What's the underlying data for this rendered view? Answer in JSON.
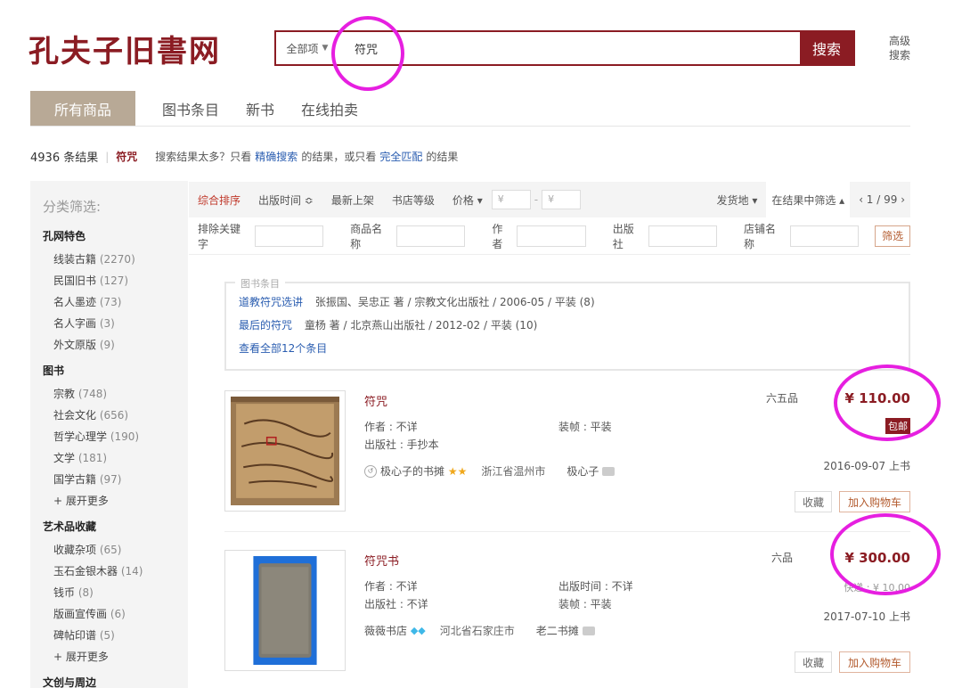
{
  "header": {
    "logo": "孔夫子旧書网",
    "scope": "全部项",
    "query": "符咒",
    "search_button": "搜索",
    "advanced_line1": "高级",
    "advanced_line2": "搜索"
  },
  "tabs": [
    "所有商品",
    "图书条目",
    "新书",
    "在线拍卖"
  ],
  "results": {
    "count": "4936 条结果",
    "keyword": "符咒",
    "hint_pre": "搜索结果太多？只看",
    "hint_link1": "精确搜索",
    "hint_mid": "的结果，或只看",
    "hint_link2": "完全匹配",
    "hint_post": "的结果"
  },
  "sidebar": {
    "title": "分类筛选:",
    "groups": [
      {
        "name": "孔网特色",
        "items": [
          {
            "label": "线装古籍",
            "count": "(2270)"
          },
          {
            "label": "民国旧书",
            "count": "(127)"
          },
          {
            "label": "名人墨迹",
            "count": "(73)"
          },
          {
            "label": "名人字画",
            "count": "(3)"
          },
          {
            "label": "外文原版",
            "count": "(9)"
          }
        ]
      },
      {
        "name": "图书",
        "items": [
          {
            "label": "宗教",
            "count": "(748)"
          },
          {
            "label": "社会文化",
            "count": "(656)"
          },
          {
            "label": "哲学心理学",
            "count": "(190)"
          },
          {
            "label": "文学",
            "count": "(181)"
          },
          {
            "label": "国学古籍",
            "count": "(97)"
          },
          {
            "label": "+ 展开更多",
            "count": ""
          }
        ]
      },
      {
        "name": "艺术品收藏",
        "items": [
          {
            "label": "收藏杂项",
            "count": "(65)"
          },
          {
            "label": "玉石金银木器",
            "count": "(14)"
          },
          {
            "label": "钱币",
            "count": "(8)"
          },
          {
            "label": "版画宣传画",
            "count": "(6)"
          },
          {
            "label": "碑帖印谱",
            "count": "(5)"
          },
          {
            "label": "+ 展开更多",
            "count": ""
          }
        ]
      },
      {
        "name": "文创与周边",
        "items": []
      }
    ]
  },
  "filters": {
    "sort_default": "综合排序",
    "sort_pubtime": "出版时间 ≎",
    "sort_new": "最新上架",
    "sort_shop": "书店等级",
    "sort_price": "价格 ▾",
    "price_from": "¥",
    "price_dash": "-",
    "price_to": "¥",
    "ship_from": "发货地 ▾",
    "in_results": "在结果中筛选 ▴",
    "pager": "‹ 1 / 99 ›",
    "exclude": "排除关键字",
    "product_name": "商品名称",
    "author": "作者",
    "publisher": "出版社",
    "shop_name": "店铺名称",
    "apply": "筛选"
  },
  "entries": {
    "legend": "图书条目",
    "rows": [
      {
        "title": "道教符咒选讲",
        "detail": "张振国、吴忠正 著 / 宗教文化出版社 / 2006-05 / 平装 (8)"
      },
      {
        "title": "最后的符咒",
        "detail": "童杨 著 / 北京燕山出版社 / 2012-02 / 平装 (10)"
      }
    ],
    "more": "查看全部12个条目"
  },
  "products": [
    {
      "title": "符咒",
      "author": "作者 : 不详",
      "publisher": "出版社 : 手抄本",
      "binding": "装帧 : 平装",
      "pubtime": "",
      "grade": "六五品",
      "price": "¥ 110.00",
      "badge": "包邮",
      "shipping": "",
      "date": "2016-09-07 上书",
      "shop_icon": "↺",
      "shop": "极心子的书摊",
      "location": "浙江省温州市",
      "seller": "极心子",
      "fav": "收藏",
      "cart": "加入购物车"
    },
    {
      "title": "符咒书",
      "author": "作者 : 不详",
      "publisher": "出版社 : 不详",
      "binding": "装帧 : 平装",
      "pubtime": "出版时间 : 不详",
      "grade": "六品",
      "price": "¥ 300.00",
      "badge": "",
      "shipping": "快递 : ¥ 10.00",
      "date": "2017-07-10 上书",
      "shop": "薇薇书店",
      "location": "河北省石家庄市",
      "seller": "老二书摊",
      "fav": "收藏",
      "cart": "加入购物车"
    }
  ],
  "colors": {
    "brand": "#8b1c23",
    "highlight": "#e61fe0",
    "tab_active": "#b8a996",
    "link": "#2a5db0"
  }
}
